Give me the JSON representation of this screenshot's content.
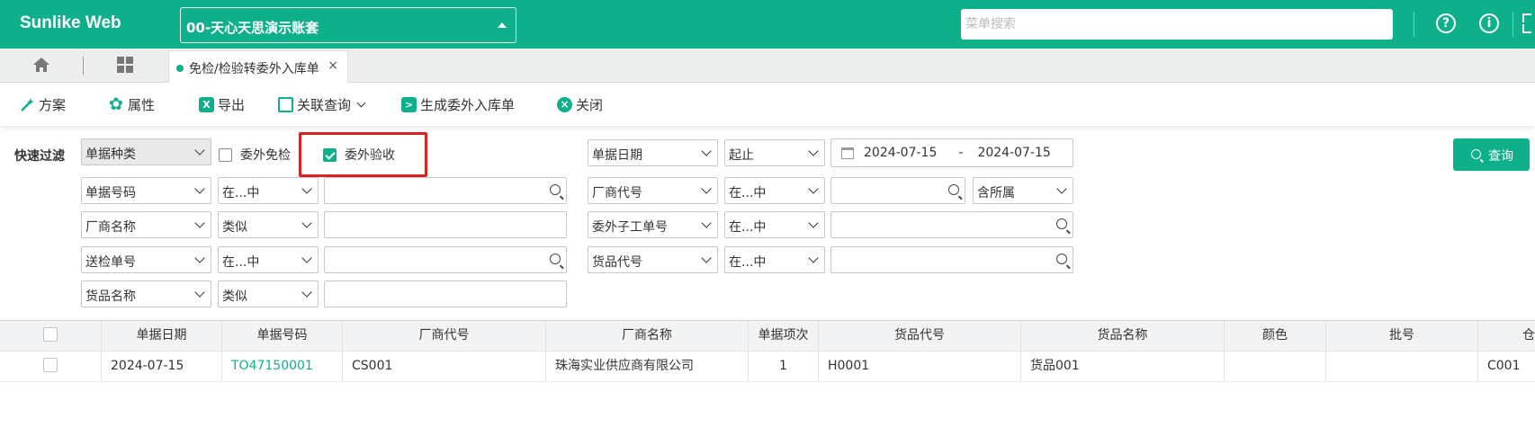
{
  "header": {
    "brand": "Sunlike Web",
    "account": "00-天心天思演示账套",
    "search_placeholder": "菜单搜索",
    "help_glyph": "?",
    "info_glyph": "i",
    "accent_color": "#0db08a"
  },
  "tabs": {
    "home_icon": "home-icon",
    "grid_icon": "grid-icon",
    "active_tab": "免检/检验转委外入库单",
    "close_glyph": "×"
  },
  "toolbar": {
    "plan": "方案",
    "properties": "属性",
    "export": "导出",
    "related_query": "关联查询",
    "generate": "生成委外入库单",
    "close": "关闭"
  },
  "filter": {
    "label": "快速过滤",
    "doc_type": "单据种类",
    "check_exempt": {
      "label": "委外免检",
      "checked": false
    },
    "check_accept": {
      "label": "委外验收",
      "checked": true
    },
    "doc_date": "单据日期",
    "date_op": "起止",
    "date_from": "2024-07-15",
    "date_sep": "-",
    "date_to": "2024-07-15",
    "query_button": "查询",
    "rows": [
      {
        "field": "单据号码",
        "op": "在...中"
      },
      {
        "field": "厂商名称",
        "op": "类似"
      },
      {
        "field": "送检单号",
        "op": "在...中"
      },
      {
        "field": "货品名称",
        "op": "类似"
      }
    ],
    "right_rows": [
      {
        "field": "厂商代号",
        "op": "在...中",
        "extra": "含所属"
      },
      {
        "field": "委外子工单号",
        "op": "在...中"
      },
      {
        "field": "货品代号",
        "op": "在...中"
      }
    ]
  },
  "grid": {
    "columns": [
      "单据日期",
      "单据号码",
      "厂商代号",
      "厂商名称",
      "单据项次",
      "货品代号",
      "货品名称",
      "颜色",
      "批号",
      "仓"
    ],
    "rows": [
      [
        "2024-07-15",
        "TO47150001",
        "CS001",
        "珠海实业供应商有限公司",
        "1",
        "H0001",
        "货品001",
        "",
        "",
        "C001"
      ]
    ]
  }
}
